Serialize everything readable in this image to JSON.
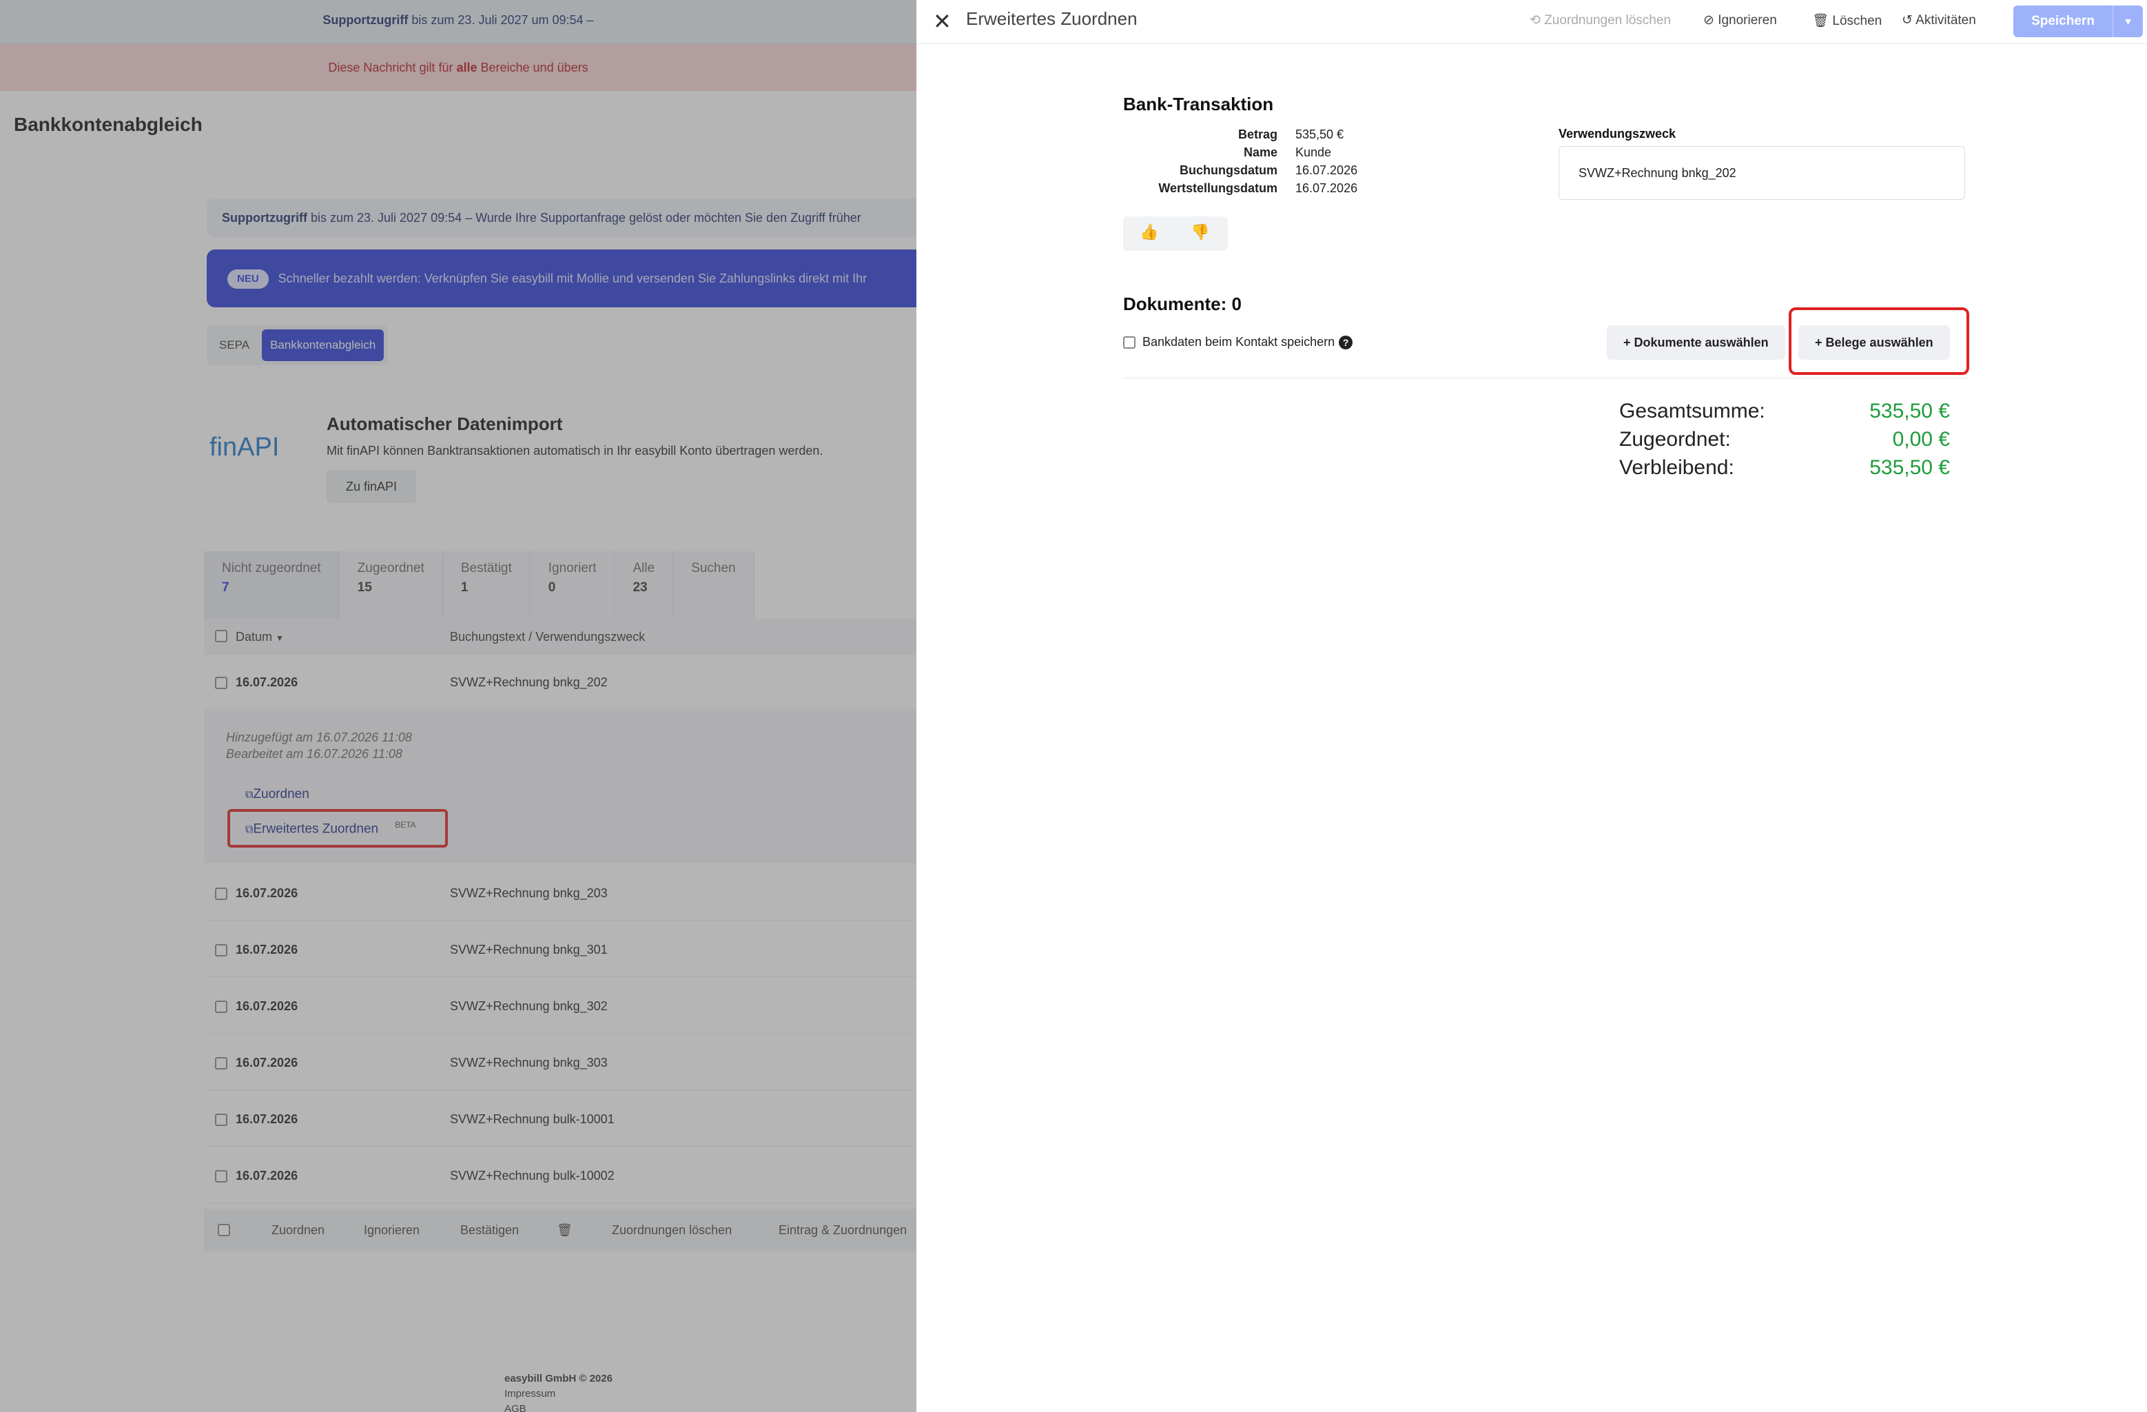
{
  "background": {
    "topbar": {
      "prefix": "Supportzugriff",
      "text": " bis zum 23. Juli 2027 um 09:54 –"
    },
    "notice": {
      "pre": "Diese Nachricht gilt für ",
      "bold": "alle",
      "post": " Bereiche und übers"
    },
    "page_title": "Bankkontenabgleich",
    "support_box": {
      "prefix": "Supportzugriff",
      "text": " bis zum 23. Juli 2027 09:54 – Wurde Ihre Supportanfrage gelöst oder möchten Sie den Zugriff früher"
    },
    "news": {
      "badge": "NEU",
      "text": "Schneller bezahlt werden: Verknüpfen Sie easybill mit Mollie und versenden Sie Zahlungslinks direkt mit Ihr"
    },
    "segments": [
      "SEPA",
      "Bankkontenabgleich"
    ],
    "import": {
      "logo_fin": "fin",
      "logo_api": "API",
      "title": "Automatischer Datenimport",
      "desc": "Mit finAPI können Banktransaktionen automatisch in Ihr easybill Konto übertragen werden.",
      "button": "Zu finAPI"
    },
    "tabs": [
      {
        "label": "Nicht zugeordnet",
        "count": "7"
      },
      {
        "label": "Zugeordnet",
        "count": "15"
      },
      {
        "label": "Bestätigt",
        "count": "1"
      },
      {
        "label": "Ignoriert",
        "count": "0"
      },
      {
        "label": "Alle",
        "count": "23"
      },
      {
        "label": "Suchen",
        "count": ""
      }
    ],
    "table_head": {
      "date": "Datum",
      "text": "Buchungstext / Verwendungszweck"
    },
    "rows": [
      {
        "date": "16.07.2026",
        "text": "SVWZ+Rechnung bnkg_202"
      },
      {
        "date": "16.07.2026",
        "text": "SVWZ+Rechnung bnkg_203"
      },
      {
        "date": "16.07.2026",
        "text": "SVWZ+Rechnung bnkg_301"
      },
      {
        "date": "16.07.2026",
        "text": "SVWZ+Rechnung bnkg_302"
      },
      {
        "date": "16.07.2026",
        "text": "SVWZ+Rechnung bnkg_303"
      },
      {
        "date": "16.07.2026",
        "text": "SVWZ+Rechnung bulk-10001"
      },
      {
        "date": "16.07.2026",
        "text": "SVWZ+Rechnung bulk-10002"
      }
    ],
    "expand": {
      "added": "Hinzugefügt am 16.07.2026 11:08",
      "edited": "Bearbeitet am 16.07.2026 11:08",
      "assign": "Zuordnen",
      "advanced": "Erweitertes Zuordnen",
      "beta": "BETA"
    },
    "bulk": [
      "Zuordnen",
      "Ignorieren",
      "Bestätigen",
      "Zuordnungen löschen",
      "Eintrag & Zuordnungen"
    ],
    "footer": [
      "easybill GmbH © 2026",
      "Impressum",
      "AGB"
    ]
  },
  "panel": {
    "title": "Erweitertes Zuordnen",
    "toolbar": {
      "delete_assignments": "Zuordnungen löschen",
      "ignore": "Ignorieren",
      "delete": "Löschen",
      "activities": "Aktivitäten",
      "save": "Speichern"
    },
    "transaction": {
      "heading": "Bank-Transaktion",
      "labels": [
        "Betrag",
        "Name",
        "Buchungsdatum",
        "Wertstellungsdatum"
      ],
      "values": [
        "535,50 €",
        "Kunde",
        "16.07.2026",
        "16.07.2026"
      ],
      "purpose_label": "Verwendungszweck",
      "purpose_value": "SVWZ+Rechnung bnkg_202"
    },
    "documents": {
      "heading": "Dokumente: 0",
      "save_bank_label": "Bankdaten beim Kontakt speichern",
      "select_documents": "Dokumente auswählen",
      "select_receipts": "Belege auswählen"
    },
    "sums": {
      "total_label": "Gesamtsumme:",
      "total_value": "535,50 €",
      "assigned_label": "Zugeordnet:",
      "assigned_value": "0,00 €",
      "remaining_label": "Verbleibend:",
      "remaining_value": "535,50 €"
    }
  }
}
